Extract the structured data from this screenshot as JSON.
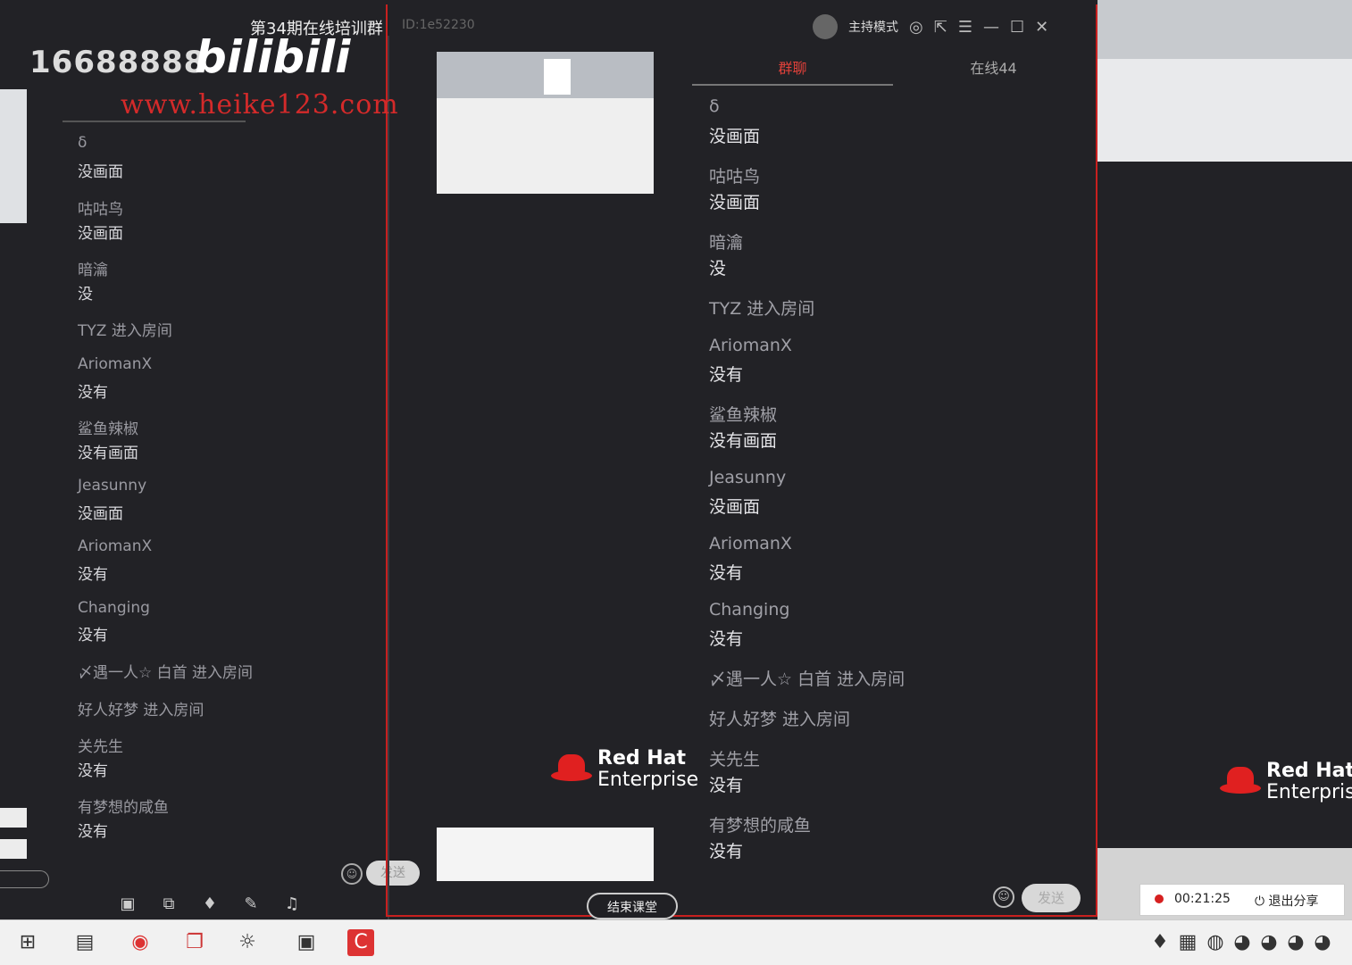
{
  "window": {
    "title": "第34期在线培训群",
    "title_id": "ID:1e52230",
    "host_mode": "主持模式"
  },
  "overlay": {
    "number": "16688888",
    "bili": "bilibili",
    "url": "www.heike123.com"
  },
  "tabs": [
    {
      "label": "群聊"
    },
    {
      "label": "在线44"
    }
  ],
  "chat_messages": [
    {
      "name": "δ",
      "msg": "没画面"
    },
    {
      "name": "咕咕鸟",
      "msg": "没画面"
    },
    {
      "name": "暗瀹",
      "msg": "没"
    },
    {
      "name": "TYZ 进入房间",
      "msg": ""
    },
    {
      "name": "AriomanX",
      "msg": "没有"
    },
    {
      "name": "鲨鱼辣椒",
      "msg": "没有画面"
    },
    {
      "name": "Jeasunny",
      "msg": "没画面"
    },
    {
      "name": "AriomanX",
      "msg": "没有"
    },
    {
      "name": "Changing",
      "msg": "没有"
    },
    {
      "name": "〆遇一人☆ 白首 进入房间",
      "msg": ""
    },
    {
      "name": "好人好梦 进入房间",
      "msg": ""
    },
    {
      "name": "关先生",
      "msg": "没有"
    },
    {
      "name": "有梦想的咸鱼",
      "msg": "没有"
    }
  ],
  "composer": {
    "emoji_icon": "emoji-icon",
    "send_label": "发送"
  },
  "end_class_label": "结束课堂",
  "recording": {
    "time": "00:21:25",
    "exit_share": "退出分享"
  },
  "redhat": {
    "line1": "Red Hat",
    "line2": "Enterprise"
  },
  "colors": {
    "accent_red": "#e0413a",
    "border_red": "#c8201f",
    "background": "#1f1f23"
  }
}
